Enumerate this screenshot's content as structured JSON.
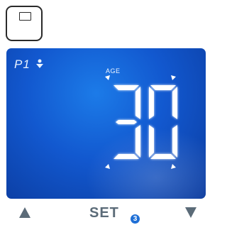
{
  "display": {
    "profile": "P1",
    "profile_icon": "person-icon",
    "field_label": "AGE",
    "value": "30",
    "colors": {
      "screen": "#1258cf",
      "segment": "#ffffff"
    }
  },
  "controls": {
    "up_icon": "triangle-up-icon",
    "set_label": "SET",
    "step_number": "3",
    "down_icon": "triangle-down-icon",
    "colors": {
      "controls": "#5b6b78",
      "badge": "#1f6fd6"
    }
  }
}
